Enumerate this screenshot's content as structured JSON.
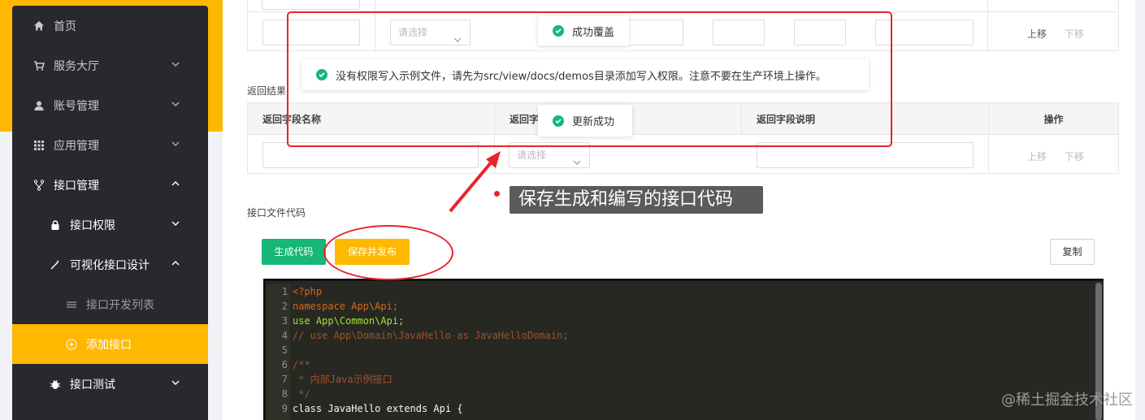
{
  "sidebar": {
    "items": [
      {
        "label": "首页",
        "icon": "home-icon"
      },
      {
        "label": "服务大厅",
        "icon": "cart-icon"
      },
      {
        "label": "账号管理",
        "icon": "user-icon"
      },
      {
        "label": "应用管理",
        "icon": "grid-icon"
      },
      {
        "label": "接口管理",
        "icon": "fork-icon"
      },
      {
        "label": "接口权限",
        "icon": "lock-icon"
      },
      {
        "label": "可视化接口设计",
        "icon": "wand-icon"
      },
      {
        "label": "接口开发列表",
        "icon": "list-icon"
      },
      {
        "label": "添加接口",
        "icon": "plus-circle-icon"
      },
      {
        "label": "接口测试",
        "icon": "bug-icon"
      }
    ]
  },
  "params_table": {
    "select_placeholder": "请选择",
    "move_up": "上移",
    "move_down": "下移"
  },
  "return_section": {
    "label": "返回结果",
    "headers": [
      "返回字段名称",
      "返回字",
      "返回字段说明",
      "操作"
    ],
    "select_placeholder": "请选择",
    "move_up": "上移",
    "move_down": "下移"
  },
  "code_section": {
    "label": "接口文件代码",
    "generate_button": "生成代码",
    "save_publish_button": "保存并发布",
    "copy_button": "复制"
  },
  "code_lines": [
    {
      "n": "1",
      "text": "<?php"
    },
    {
      "n": "2",
      "text": "namespace App\\Api;"
    },
    {
      "n": "3",
      "text": "use App\\Common\\Api;"
    },
    {
      "n": "4",
      "text": "// use App\\Domain\\JavaHello as JavaHelloDomain;"
    },
    {
      "n": "5",
      "text": ""
    },
    {
      "n": "6",
      "text": "/**"
    },
    {
      "n": "7",
      "text": " * 内部Java示例接口"
    },
    {
      "n": "8",
      "text": " */"
    },
    {
      "n": "9",
      "text": "class JavaHello extends Api {"
    }
  ],
  "toasts": {
    "success_overwrite": "成功覆盖",
    "permission_warning": "没有权限写入示例文件，请先为src/view/docs/demos目录添加写入权限。注意不要在生产环境上操作。",
    "update_success": "更新成功"
  },
  "annotation": {
    "callout": "保存生成和编写的接口代码"
  },
  "watermark": "@稀土掘金技术社区",
  "colors": {
    "accent": "#ffb800",
    "success": "#16b777",
    "annotation_red": "#e8232c",
    "sidebar_bg": "#28292f"
  }
}
